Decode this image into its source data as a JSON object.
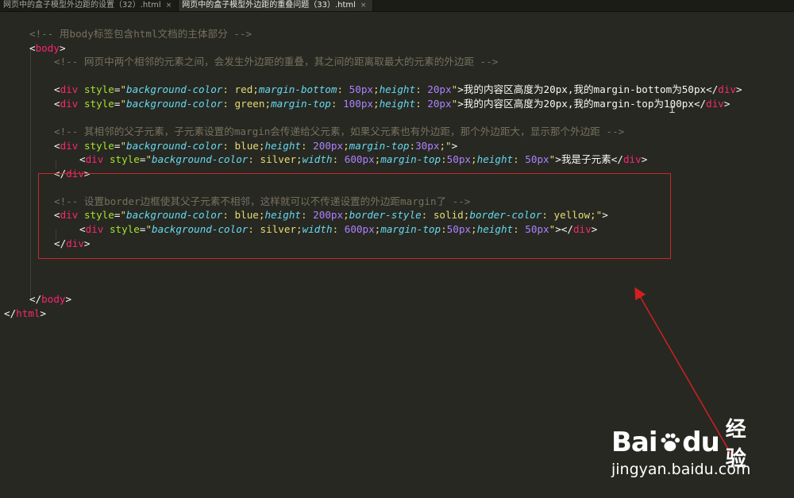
{
  "tabs": [
    {
      "label": "网页中的盒子模型外边距的设置（32）.html",
      "close": "×",
      "active": false
    },
    {
      "label": "网页中的盒子模型外边距的重叠问题（33）.html",
      "close": "×",
      "active": true
    }
  ],
  "code": {
    "c1": "<!-- 用body标签包含html文档的主体部分 -->",
    "body_open": "body",
    "c2": "<!-- 网页中两个相邻的元素之间，会发生外边距的重叠，其之间的距离取最大的元素的外边距 -->",
    "text_red": "我的内容区高度为20px,我的margin-bottom为50px",
    "text_green": "我的内容区高度为20px,我的margin-top为100px",
    "c3": "<!-- 其相邻的父子元素，子元素设置的margin会传递给父元素，如果父元素也有外边距，那个外边距大，显示那个外边距 -->",
    "child_text": "我是子元素",
    "c4": "<!-- 设置border边框使其父子元素不相邻，这样就可以不传递设置的外边距margin了 -->",
    "body_close": "body",
    "html_close": "html",
    "div": "div",
    "style_attr": "style",
    "values": {
      "red": "red",
      "green": "green",
      "blue": "blue",
      "silver": "silver",
      "solid": "solid",
      "yellow": "yellow",
      "v50": "50",
      "v20": "20",
      "v100": "100",
      "v200": "200",
      "v30": "30",
      "v600": "600",
      "px": "px"
    },
    "props": {
      "bg": "background-color",
      "mb": "margin-bottom",
      "mt": "margin-top",
      "h": "height",
      "w": "width",
      "bs": "border-style",
      "bc": "border-color"
    }
  },
  "watermark": {
    "logo_bai": "Bai",
    "logo_du": "du",
    "logo_cn": "经验",
    "url": "jingyan.baidu.com"
  },
  "colors": {
    "background": "#272822",
    "comment": "#75715e",
    "tag": "#f92672",
    "attr": "#a6e22e",
    "string": "#e6db74",
    "property": "#66d9ef",
    "number": "#ae81ff",
    "highlight_box": "#c9282a"
  }
}
